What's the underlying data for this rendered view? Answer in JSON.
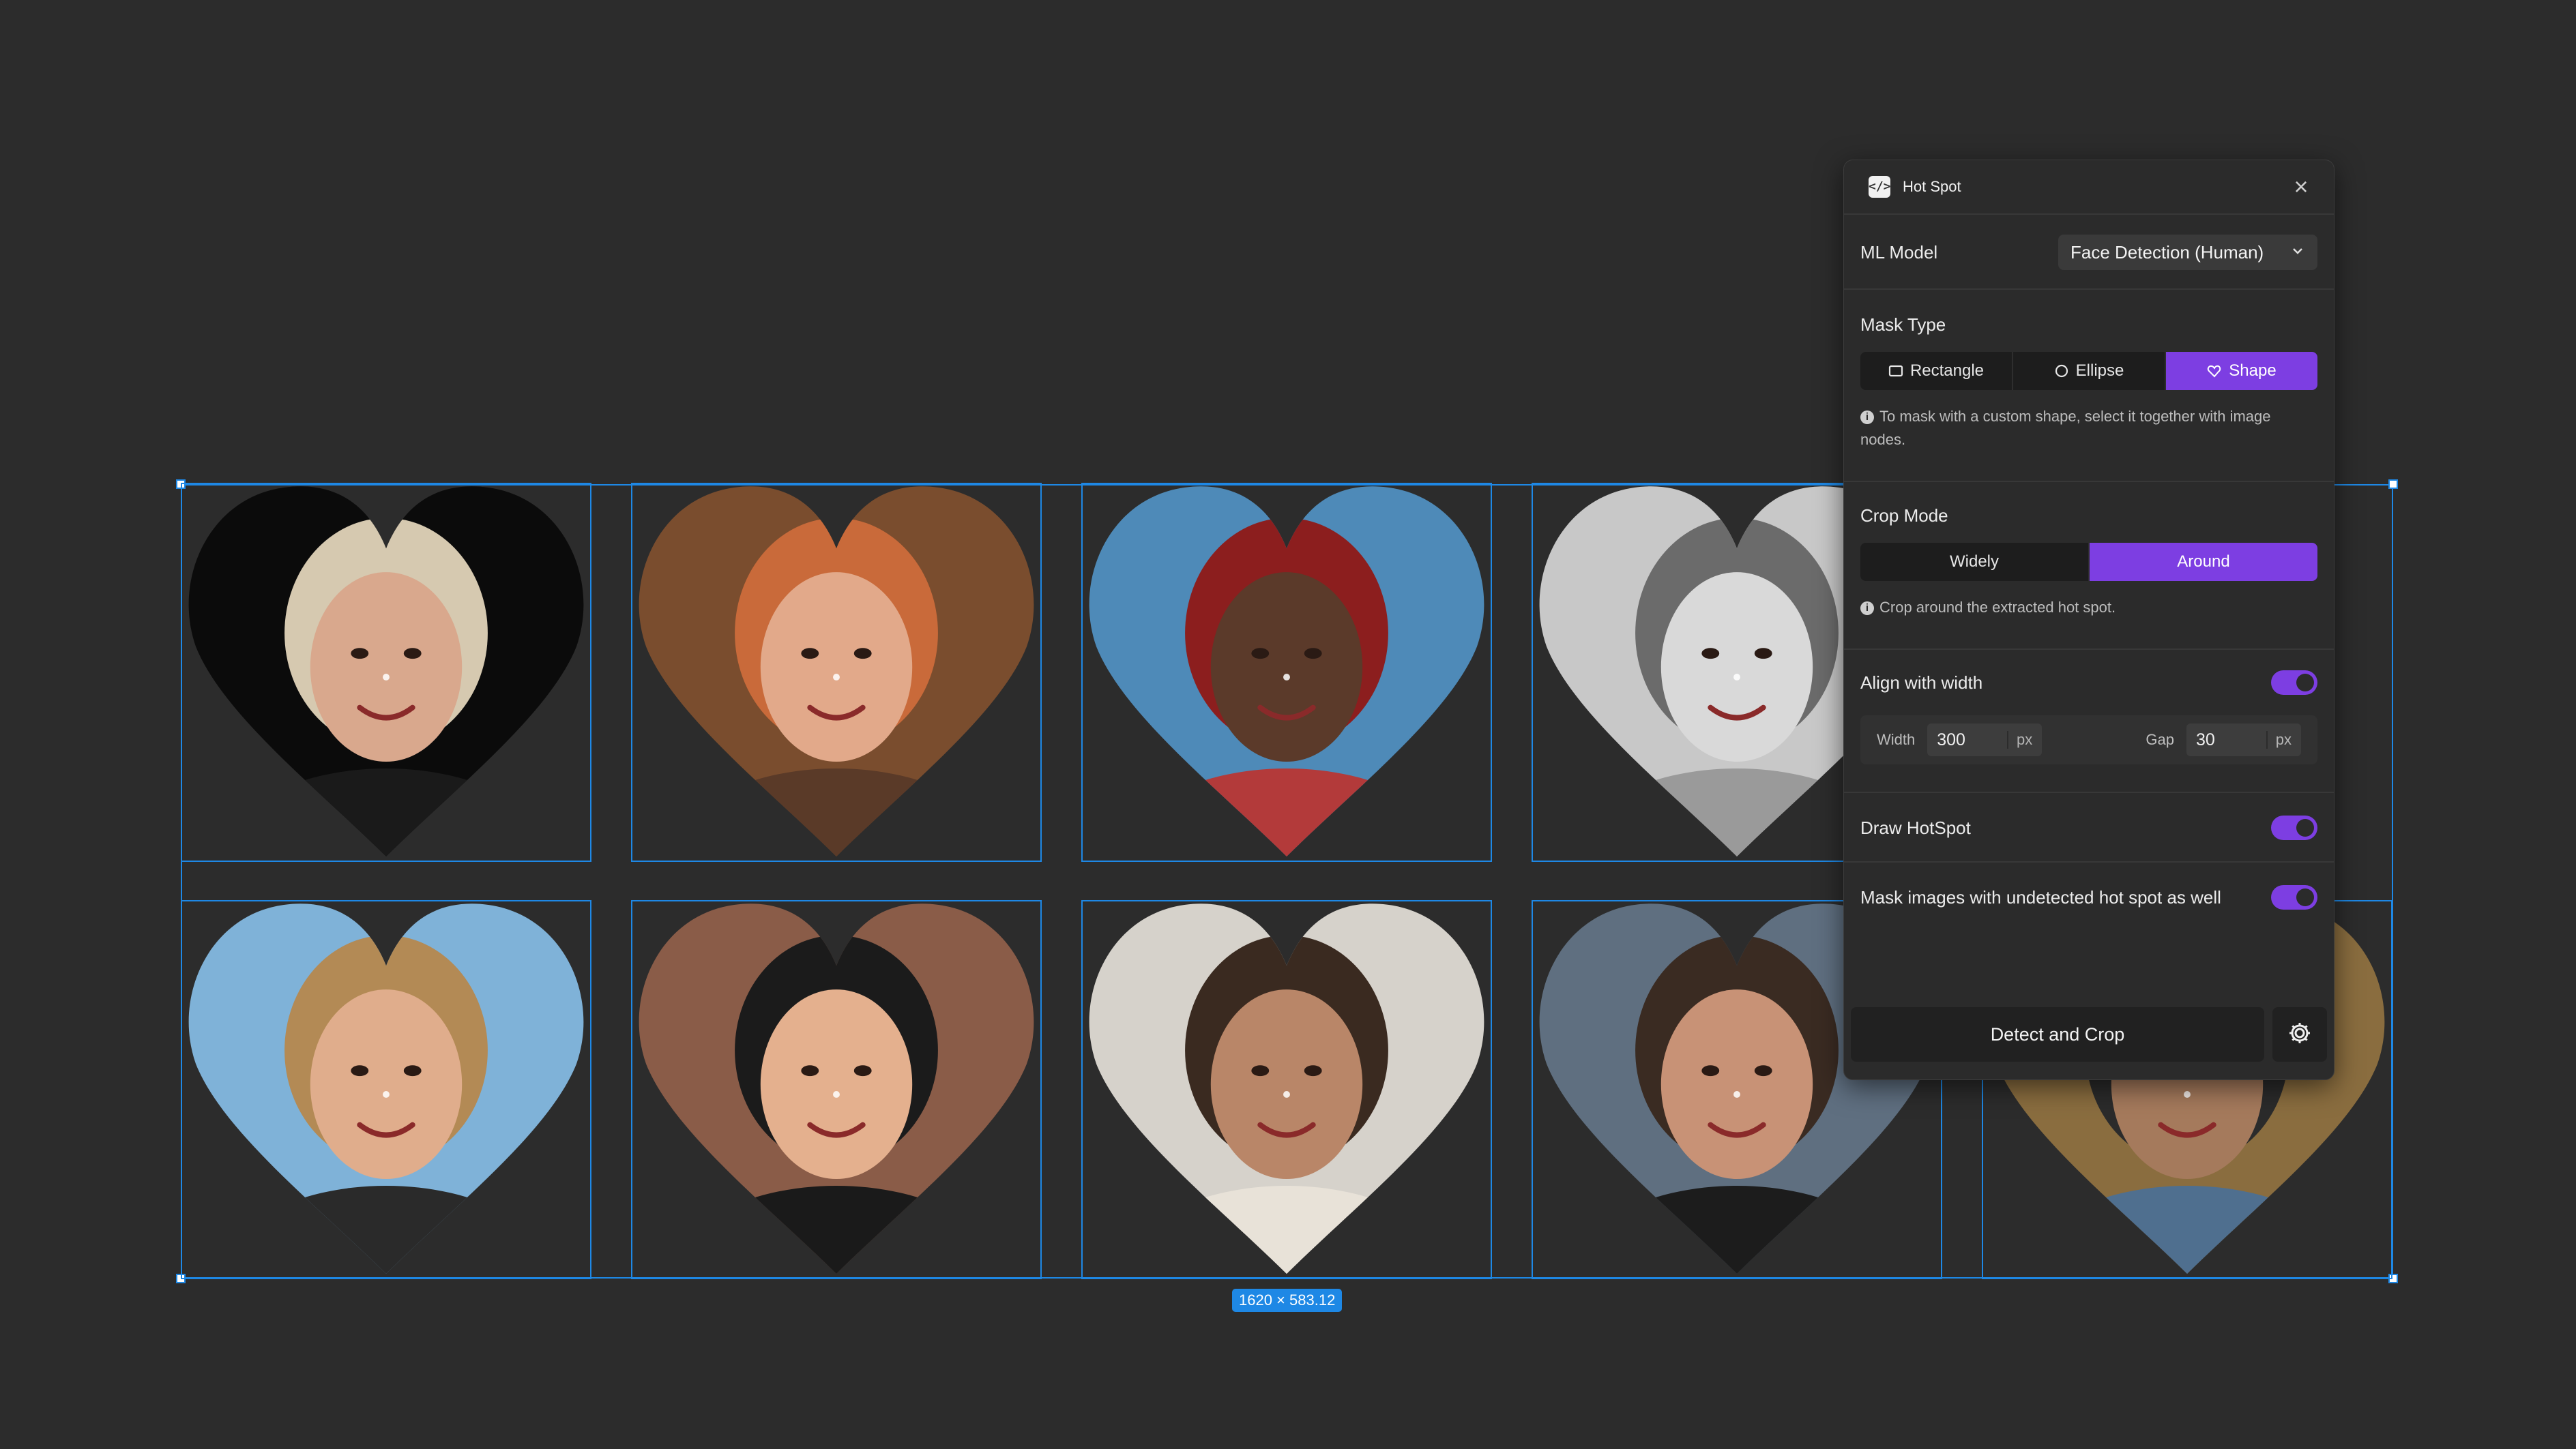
{
  "canvas": {
    "selection_size_label": "1620 × 583.12",
    "frames": [
      {
        "name": "heart-photo-1",
        "skin": "#d9a88d",
        "hair": "#d6c9b0",
        "bg": "#0b0b0b",
        "shirt": "#1a1a1a"
      },
      {
        "name": "heart-photo-2",
        "skin": "#e2a98a",
        "hair": "#c96a3a",
        "bg": "#7a4d2e",
        "shirt": "#5a3a28"
      },
      {
        "name": "heart-photo-3",
        "skin": "#5b3a2a",
        "hair": "#8c1e1e",
        "bg": "#4e8ab8",
        "shirt": "#b33a3a"
      },
      {
        "name": "heart-photo-4",
        "skin": "#d9d9d9",
        "hair": "#6b6b6b",
        "bg": "#c8c8c8",
        "shirt": "#9a9a9a"
      },
      {
        "name": "heart-photo-5",
        "skin": "#e0ad8c",
        "hair": "#b38a55",
        "bg": "#7fb2d8",
        "shirt": "#2a2a2a"
      },
      {
        "name": "heart-photo-6",
        "skin": "#e4b08e",
        "hair": "#1b1b1b",
        "bg": "#8a5c48",
        "shirt": "#1a1a1a"
      },
      {
        "name": "heart-photo-7",
        "skin": "#b98668",
        "hair": "#3a2a20",
        "bg": "#d6d2cb",
        "shirt": "#e8e2d8"
      },
      {
        "name": "heart-photo-8",
        "skin": "#c89276",
        "hair": "#3a2b22",
        "bg": "#5f6f80",
        "shirt": "#1c1c1c"
      },
      {
        "name": "heart-photo-9",
        "skin": "#a57a5c",
        "hair": "#2b2b2b",
        "bg": "#8a6d3f",
        "shirt": "#4f6f8f"
      }
    ]
  },
  "panel": {
    "title": "Hot Spot",
    "ml_model": {
      "label": "ML Model",
      "value": "Face Detection (Human)"
    },
    "mask_type": {
      "label": "Mask Type",
      "options": [
        "Rectangle",
        "Ellipse",
        "Shape"
      ],
      "selected": "Shape",
      "hint": "To mask with a custom shape, select it together with image nodes."
    },
    "crop_mode": {
      "label": "Crop Mode",
      "options": [
        "Widely",
        "Around"
      ],
      "selected": "Around",
      "hint": "Crop around the extracted hot spot."
    },
    "align_with_width": {
      "label": "Align with width",
      "enabled": true,
      "width_label": "Width",
      "width_value": "300",
      "gap_label": "Gap",
      "gap_value": "30",
      "unit": "px"
    },
    "draw_hotspot": {
      "label": "Draw HotSpot",
      "enabled": true
    },
    "mask_undetected": {
      "label": "Mask images with undetected hot spot as well",
      "enabled": true
    },
    "detect_button": "Detect and Crop"
  },
  "colors": {
    "accent": "#7d3ee2",
    "selection": "#1e88e5"
  }
}
